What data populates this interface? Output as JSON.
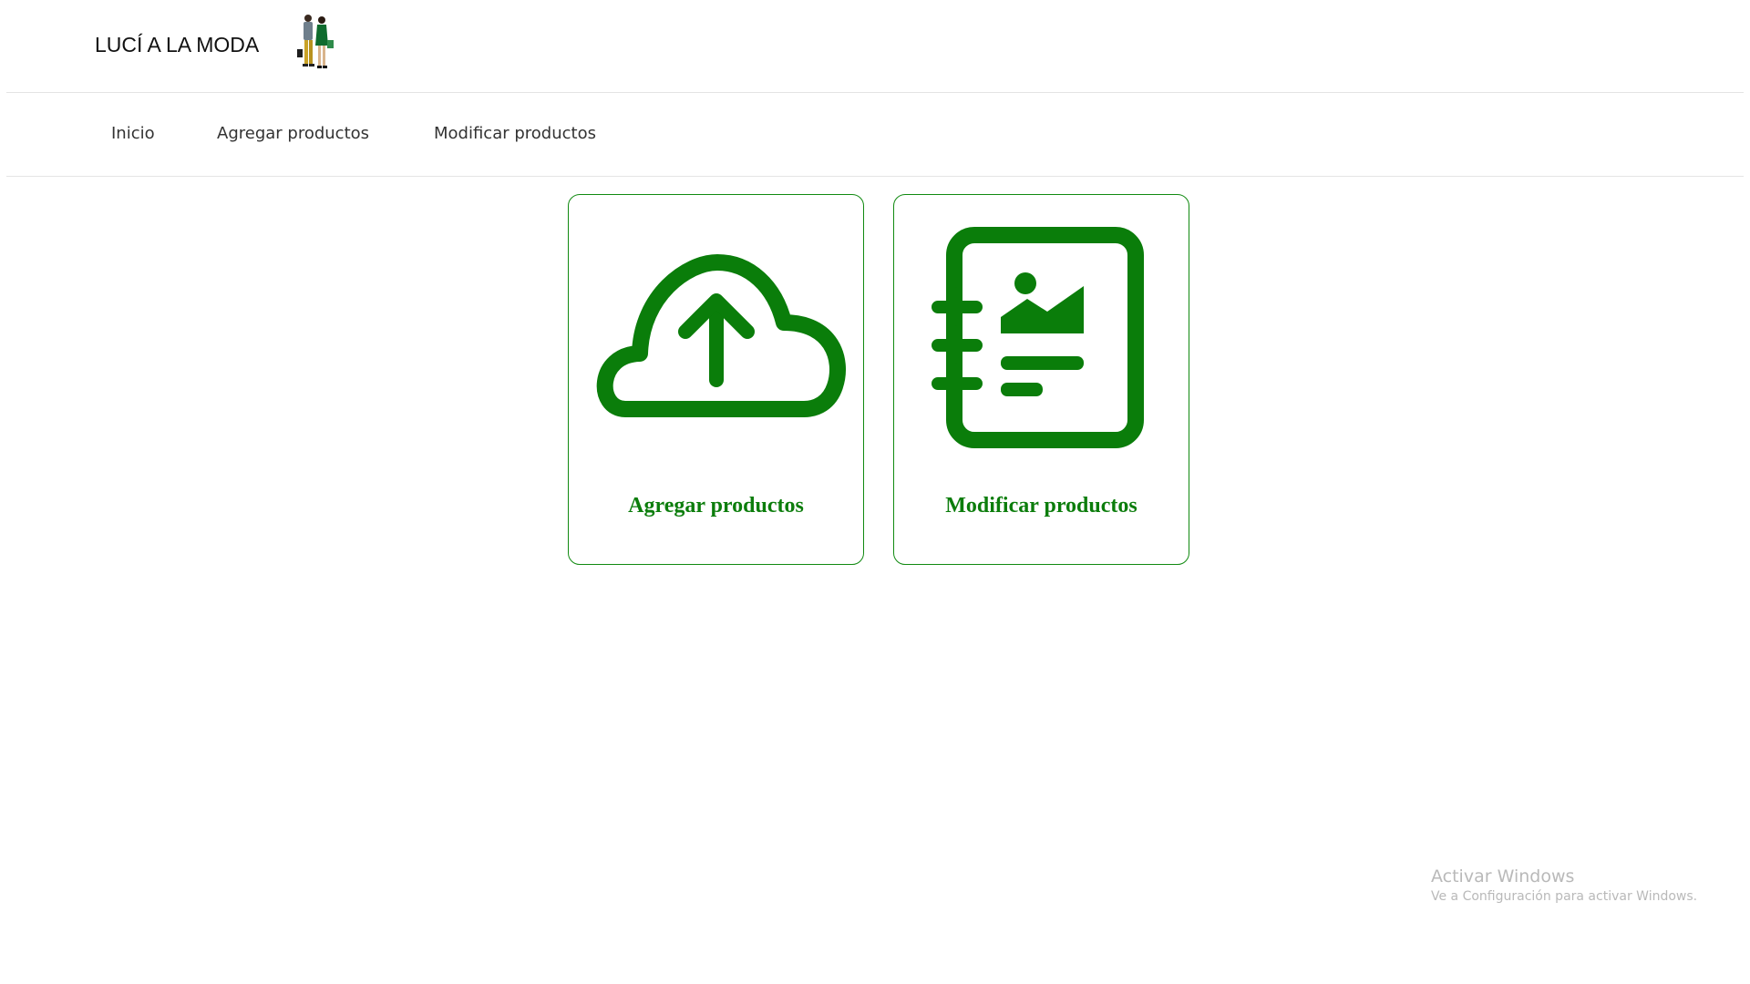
{
  "brand": {
    "title": "LUCÍ A LA MODA",
    "logo_icon": "fashion-couple-logo"
  },
  "nav": {
    "items": [
      {
        "label": "Inicio"
      },
      {
        "label": "Agregar productos"
      },
      {
        "label": "Modificar productos"
      }
    ]
  },
  "cards": [
    {
      "label": "Agregar productos",
      "icon": "cloud-upload-icon"
    },
    {
      "label": "Modificar productos",
      "icon": "product-catalog-icon"
    }
  ],
  "colors": {
    "accent": "#0a7d0a",
    "border": "#118a11"
  },
  "watermark": {
    "title": "Activar Windows",
    "subtitle": "Ve a Configuración para activar Windows."
  }
}
